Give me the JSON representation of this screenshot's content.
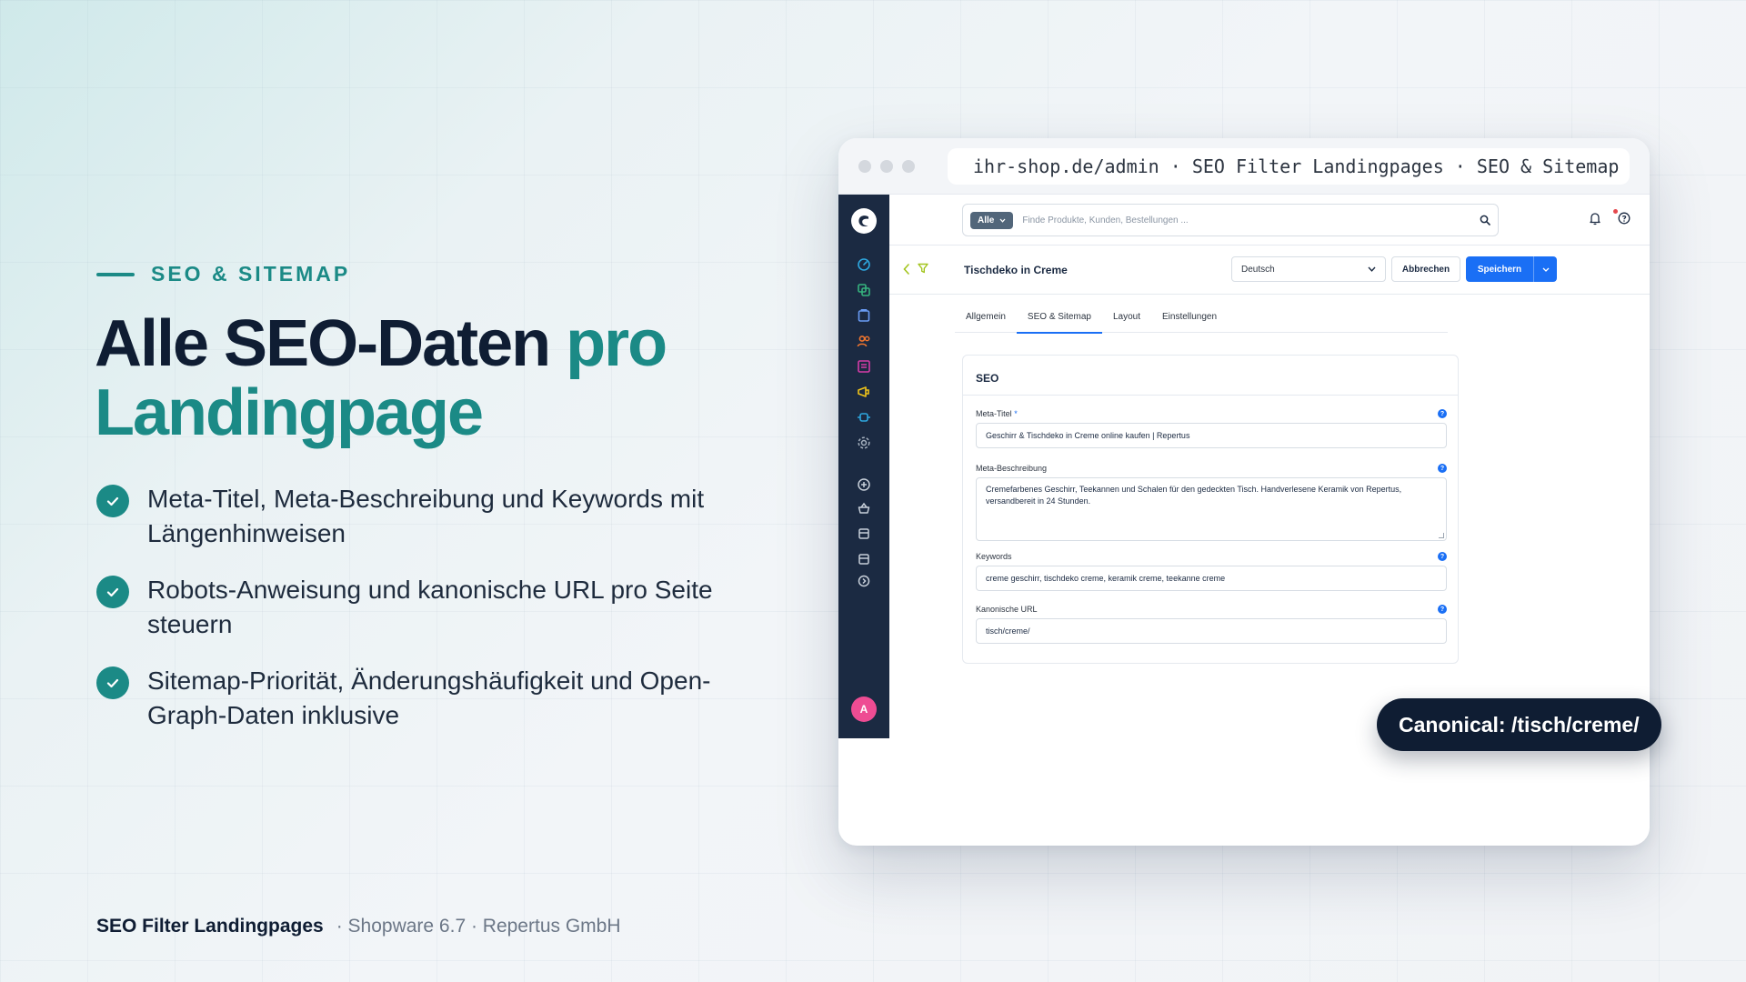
{
  "hero": {
    "eyebrow": "SEO & SITEMAP",
    "headline_part1": "Alle SEO-Daten ",
    "headline_accent": "pro Landingpage",
    "features": [
      "Meta-Titel, Meta-Beschreibung und Keywords mit Längenhinweisen",
      "Robots-Anweisung und kanonische URL pro Seite steuern",
      "Sitemap-Priorität, Änderungshäufigkeit und Open-Graph-Daten inklusive"
    ]
  },
  "footer": {
    "product": "SEO Filter Landingpages",
    "meta": "· Shopware 6.7 · Repertus GmbH"
  },
  "browser": {
    "url": "ihr-shop.de/admin · SEO Filter Landingpages · SEO & Sitemap"
  },
  "admin": {
    "search": {
      "scope": "Alle",
      "placeholder": "Finde Produkte, Kunden, Bestellungen ..."
    },
    "avatar_initial": "A",
    "page_title": "Tischdeko in Creme",
    "language": "Deutsch",
    "cancel_label": "Abbrechen",
    "save_label": "Speichern",
    "tabs": [
      "Allgemein",
      "SEO & Sitemap",
      "Layout",
      "Einstellungen"
    ],
    "active_tab": "SEO & Sitemap",
    "card_title": "SEO",
    "fields": {
      "meta_title_label": "Meta-Titel",
      "meta_title_required": "*",
      "meta_title_value": "Geschirr & Tischdeko in Creme online kaufen | Repertus",
      "meta_description_label": "Meta-Beschreibung",
      "meta_description_value": "Cremefarbenes Geschirr, Teekannen und Schalen für den gedeckten Tisch. Handverlesene Keramik von Repertus, versandbereit in 24 Stunden.",
      "keywords_label": "Keywords",
      "keywords_value": "creme geschirr, tischdeko creme, keramik creme, teekanne creme",
      "canonical_label": "Kanonische URL",
      "canonical_value": "tisch/creme/",
      "help_glyph": "?"
    }
  },
  "callout": "Canonical: /tisch/creme/",
  "colors": {
    "accent": "#1b8a86",
    "navy": "#0f1d33",
    "primary_button": "#1a6ff5",
    "sidebar": "#1b2a42"
  }
}
